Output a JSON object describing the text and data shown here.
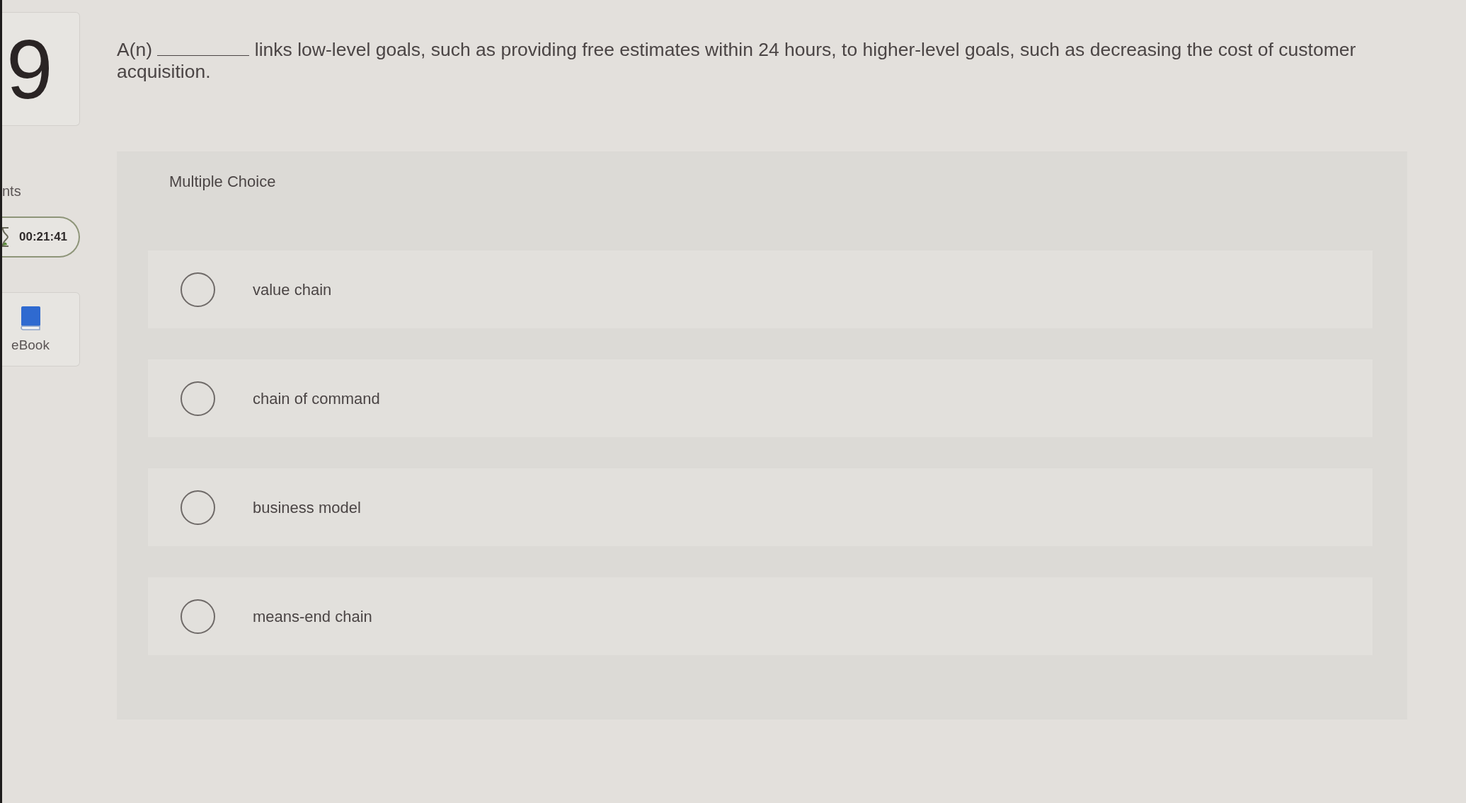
{
  "sidebar": {
    "question_number": "9",
    "points_label": "nts",
    "timer": {
      "time": "00:21:41"
    },
    "ebook": {
      "label": "eBook"
    }
  },
  "question": {
    "before_blank": "A(n)",
    "after_blank": "links low-level goals, such as providing free estimates within 24 hours, to higher-level goals, such as decreasing the cost of customer acquisition."
  },
  "choices": {
    "heading": "Multiple Choice",
    "options": [
      {
        "label": "value chain",
        "selected": false
      },
      {
        "label": "chain of command",
        "selected": false
      },
      {
        "label": "business model",
        "selected": false
      },
      {
        "label": "means-end chain",
        "selected": false
      }
    ]
  }
}
